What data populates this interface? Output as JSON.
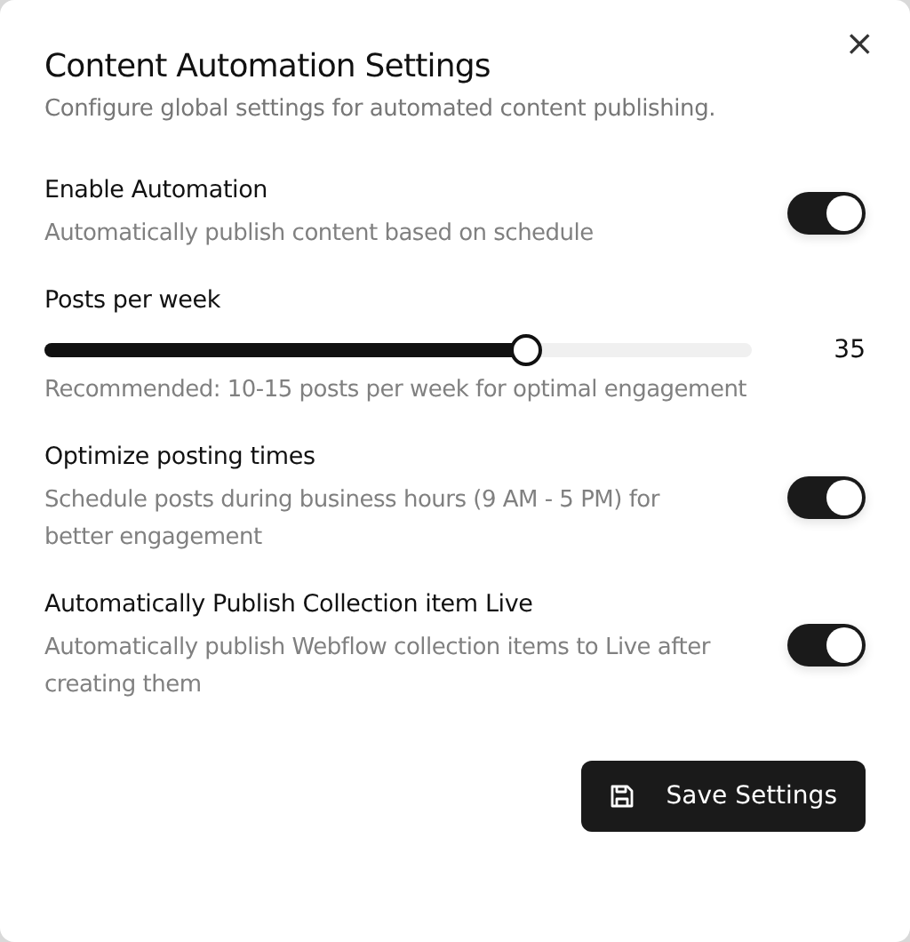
{
  "dialog": {
    "title": "Content Automation Settings",
    "subtitle": "Configure global settings for automated content publishing.",
    "close": "×"
  },
  "settings": [
    {
      "kind": "toggle",
      "label": "Enable Automation",
      "description": "Automatically publish content based on schedule",
      "on": true
    },
    {
      "kind": "slider",
      "label": "Posts per week",
      "level": 0.68,
      "reading": "35",
      "description": "Recommended: 10-15 posts per week for optimal engagement"
    },
    {
      "kind": "toggle",
      "label": "Optimize posting times",
      "description": "Schedule posts during business hours (9 AM - 5 PM) for better engagement",
      "on": true
    },
    {
      "kind": "toggle",
      "label": "Automatically Publish Collection item Live",
      "description": "Automatically publish Webflow collection items to Live after creating them",
      "on": true
    }
  ],
  "save_button": {
    "label": "Save Settings"
  }
}
